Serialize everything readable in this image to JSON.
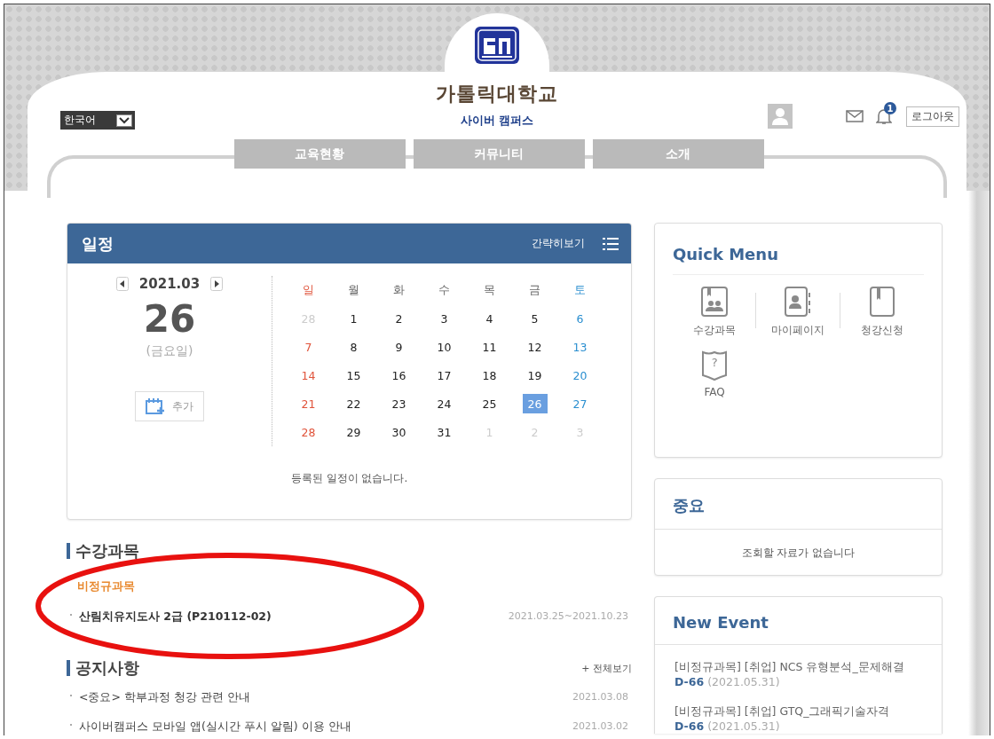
{
  "header": {
    "language": "한국어",
    "university": "가톨릭대학교",
    "campus": "사이버 캠퍼스",
    "notification_count": "1",
    "logout": "로그아웃"
  },
  "nav": [
    {
      "label": "교육현황"
    },
    {
      "label": "커뮤니티"
    },
    {
      "label": "소개"
    }
  ],
  "schedule": {
    "title": "일정",
    "view_toggle": "간략히보기",
    "month": "2021.03",
    "day": "26",
    "weekday": "(금요일)",
    "add": "추가",
    "weekdays": [
      "일",
      "월",
      "화",
      "수",
      "목",
      "금",
      "토"
    ],
    "weeks": [
      [
        {
          "d": "28",
          "muted": true,
          "selected": false
        },
        {
          "d": "1",
          "muted": false,
          "selected": false
        },
        {
          "d": "2",
          "muted": false,
          "selected": false
        },
        {
          "d": "3",
          "muted": false,
          "selected": false
        },
        {
          "d": "4",
          "muted": false,
          "selected": false
        },
        {
          "d": "5",
          "muted": false,
          "selected": false
        },
        {
          "d": "6",
          "muted": false,
          "selected": false
        }
      ],
      [
        {
          "d": "7",
          "muted": false,
          "selected": false
        },
        {
          "d": "8",
          "muted": false,
          "selected": false
        },
        {
          "d": "9",
          "muted": false,
          "selected": false
        },
        {
          "d": "10",
          "muted": false,
          "selected": false
        },
        {
          "d": "11",
          "muted": false,
          "selected": false
        },
        {
          "d": "12",
          "muted": false,
          "selected": false
        },
        {
          "d": "13",
          "muted": false,
          "selected": false
        }
      ],
      [
        {
          "d": "14",
          "muted": false,
          "selected": false
        },
        {
          "d": "15",
          "muted": false,
          "selected": false
        },
        {
          "d": "16",
          "muted": false,
          "selected": false
        },
        {
          "d": "17",
          "muted": false,
          "selected": false
        },
        {
          "d": "18",
          "muted": false,
          "selected": false
        },
        {
          "d": "19",
          "muted": false,
          "selected": false
        },
        {
          "d": "20",
          "muted": false,
          "selected": false
        }
      ],
      [
        {
          "d": "21",
          "muted": false,
          "selected": false
        },
        {
          "d": "22",
          "muted": false,
          "selected": false
        },
        {
          "d": "23",
          "muted": false,
          "selected": false
        },
        {
          "d": "24",
          "muted": false,
          "selected": false
        },
        {
          "d": "25",
          "muted": false,
          "selected": false
        },
        {
          "d": "26",
          "muted": false,
          "selected": true
        },
        {
          "d": "27",
          "muted": false,
          "selected": false
        }
      ],
      [
        {
          "d": "28",
          "muted": false,
          "selected": false
        },
        {
          "d": "29",
          "muted": false,
          "selected": false
        },
        {
          "d": "30",
          "muted": false,
          "selected": false
        },
        {
          "d": "31",
          "muted": false,
          "selected": false
        },
        {
          "d": "1",
          "muted": true,
          "selected": false
        },
        {
          "d": "2",
          "muted": true,
          "selected": false
        },
        {
          "d": "3",
          "muted": true,
          "selected": false
        }
      ]
    ],
    "empty": "등록된 일정이 없습니다."
  },
  "courses": {
    "title": "수강과목",
    "category": "비정규과목",
    "items": [
      {
        "name": "산림치유지도사 2급 (P210112-02)",
        "period": "2021.03.25~2021.10.23"
      }
    ]
  },
  "notices": {
    "title": "공지사항",
    "more": "+ 전체보기",
    "items": [
      {
        "title": "<중요> 학부과정 청강 관련 안내",
        "date": "2021.03.08"
      },
      {
        "title": "사이버캠퍼스 모바일 앱(실시간 푸시 알림) 이용 안내",
        "date": "2021.03.02"
      }
    ]
  },
  "quick_menu": {
    "title": "Quick Menu",
    "items": [
      {
        "kind": "courses",
        "label": "수강과목"
      },
      {
        "kind": "mypage",
        "label": "마이페이지"
      },
      {
        "kind": "apply",
        "label": "청강신청"
      },
      {
        "kind": "faq",
        "label": "FAQ",
        "glyph": "?"
      }
    ]
  },
  "important": {
    "title": "중요",
    "empty": "조회할 자료가 없습니다"
  },
  "new_event": {
    "title": "New Event",
    "items": [
      {
        "title": "[비정규과목] [취업] NCS 유형분석_문제해결",
        "dday": "D-66",
        "date": "(2021.05.31)"
      },
      {
        "title": "[비정규과목] [취업] GTQ_그래픽기술자격",
        "dday": "D-66",
        "date": "(2021.05.31)"
      }
    ]
  }
}
